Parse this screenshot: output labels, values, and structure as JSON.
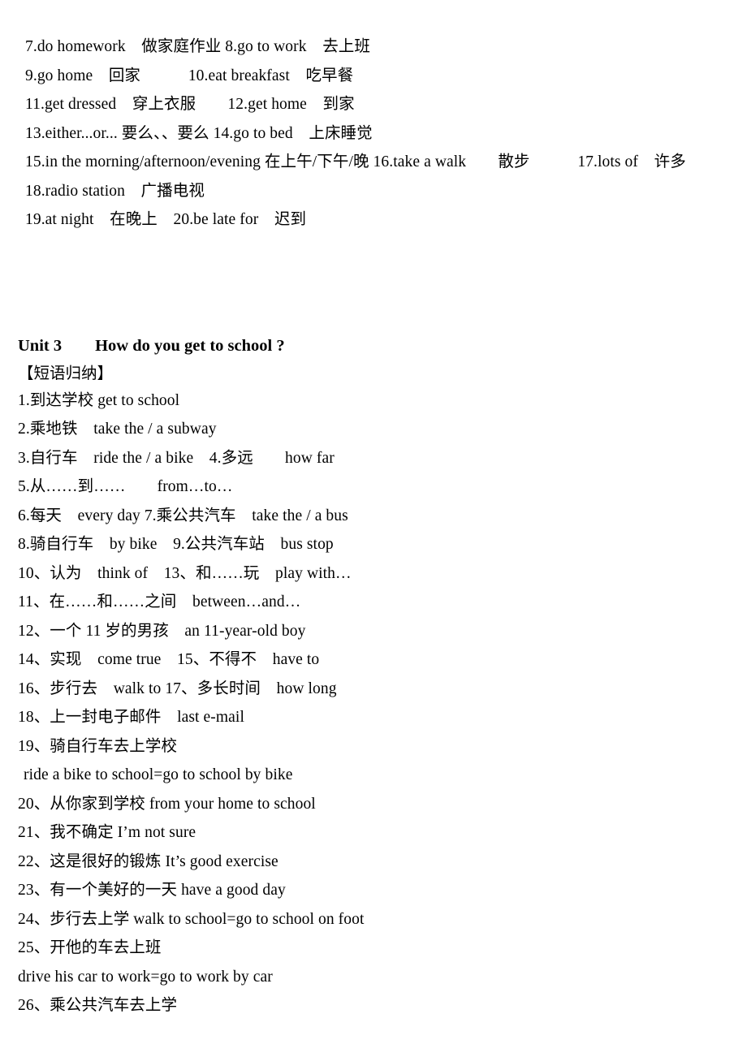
{
  "document": {
    "type": "study-notes",
    "language": "zh-CN / en",
    "background_color": "#ffffff",
    "text_color": "#000000"
  },
  "top_block": {
    "name": "unit2-phrase-list-continued",
    "lines": [
      "7.do homework　做家庭作业 8.go to work　去上班",
      "9.go home　回家　　　10.eat breakfast　吃早餐",
      "11.get dressed　穿上衣服　　12.get home　到家",
      "13.either...or... 要么、、要么 14.go to bed　上床睡觉",
      "15.in the morning/afternoon/evening 在上午/下午/晚 16.take a walk　　散步　　　17.lots of　许多",
      "18.radio station　广播电视",
      "19.at night　在晚上　20.be late for　迟到"
    ]
  },
  "unit3": {
    "heading": "Unit 3　　How do you get to school ?",
    "subheading": "【短语归纳】",
    "lines": [
      {
        "text": "1.到达学校 get to school",
        "indent": "none"
      },
      {
        "text": "2.乘地铁　take the / a subway",
        "indent": "none"
      },
      {
        "text": "3.自行车　ride the / a bike　4.多远　　how far",
        "indent": "none"
      },
      {
        "text": "5.从……到……　　from…to…",
        "indent": "none"
      },
      {
        "text": "6.每天　every day 7.乘公共汽车　take the / a bus",
        "indent": "none"
      },
      {
        "text": "8.骑自行车　by bike　9.公共汽车站　bus stop",
        "indent": "none"
      },
      {
        "text": "10、认为　think of　13、和……玩　play with…",
        "indent": "none"
      },
      {
        "text": "11、在……和……之间　between…and…",
        "indent": "none"
      },
      {
        "text": "12、一个 11 岁的男孩　an 11-year-old boy",
        "indent": "none"
      },
      {
        "text": "14、实现　come true　15、不得不　have to",
        "indent": "none"
      },
      {
        "text": "16、步行去　walk to 17、多长时间　how long",
        "indent": "none"
      },
      {
        "text": "18、上一封电子邮件　last e-mail",
        "indent": "none"
      },
      {
        "text": "19、骑自行车去上学校",
        "indent": "none"
      },
      {
        "text": "ride a bike to school=go to school by bike",
        "indent": "small"
      },
      {
        "text": "20、从你家到学校 from your home to school",
        "indent": "none"
      },
      {
        "text": "21、我不确定 I’m not sure",
        "indent": "none"
      },
      {
        "text": "22、这是很好的锻炼 It’s good exercise",
        "indent": "none"
      },
      {
        "text": "23、有一个美好的一天 have a good day",
        "indent": "none"
      },
      {
        "text": "24、步行去上学 walk to school=go to school on foot",
        "indent": "none"
      },
      {
        "text": "25、开他的车去上班",
        "indent": "none"
      },
      {
        "text": "drive his car to work=go to work by car",
        "indent": "none"
      },
      {
        "text": "26、乘公共汽车去上学",
        "indent": "none"
      }
    ]
  }
}
